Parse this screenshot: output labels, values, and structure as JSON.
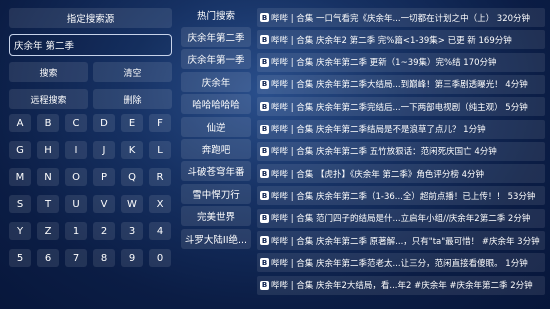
{
  "left_panel": {
    "specify_source_label": "指定搜索源",
    "search_value": "庆余年 第二季",
    "search_button": "搜索",
    "clear_button": "清空",
    "remote_search_button": "远程搜索",
    "delete_button": "删除",
    "keys": [
      "A",
      "B",
      "C",
      "D",
      "E",
      "F",
      "G",
      "H",
      "I",
      "J",
      "K",
      "L",
      "M",
      "N",
      "O",
      "P",
      "Q",
      "R",
      "S",
      "T",
      "U",
      "V",
      "W",
      "X",
      "Y",
      "Z",
      "1",
      "2",
      "3",
      "4",
      "5",
      "6",
      "7",
      "8",
      "9",
      "0"
    ]
  },
  "hot": {
    "title": "热门搜索",
    "items": [
      "庆余年第二季",
      "庆余年第一季",
      "庆余年",
      "哈哈哈哈哈",
      "仙逆",
      "奔跑吧",
      "斗破苍穹年番",
      "雪中悍刀行",
      "完美世界",
      "斗罗大陆II绝..."
    ]
  },
  "results": {
    "icon": "bilibili-icon",
    "items": [
      "哔哔 | 合集  一口气看完《庆余年...一切都在计划之中（上） 320分钟",
      "哔哔 | 合集  庆余年2 第二季 完%篇<1-39集> 已更 新 169分钟",
      "哔哔 | 合集  庆余年第二季 更新（1~39集）完%结 170分钟",
      "哔哔 | 合集  庆余年第二季大结局...到巅峰！第三季剧透曝光！ 4分钟",
      "哔哔 | 合集  庆余年第二季完结后...一下两部电视剧（纯主观） 5分钟",
      "哔哔 | 合集  庆余年第二季结局是不是浪草了点儿？ 1分钟",
      "哔哔 | 合集  庆余年第二季 五竹放狠话：范闲死庆国亡 4分钟",
      "哔哔 | 合集  【虎扑】《庆余年 第二季》角色评分榜 4分钟",
      "哔哔 | 合集  庆余年第二季（1-36...全）超前点播！已上传！！ 53分钟",
      "哔哔 | 合集  范门四子的结局是什...立启年小组//庆余年2第二季 2分钟",
      "哔哔 | 合集  庆余年第二季 原著解...，只有\"ta\"最可惜！ #庆余年 3分钟",
      "哔哔 | 合集  庆余年第二季范老太...让三分，范闲直接看傻眼。 1分钟",
      "哔哔 | 合集  庆余年2大结局，看...年2 #庆余年 #庆余年第二季 2分钟"
    ]
  },
  "colors": {
    "background": "#0b1d45",
    "button_fill": "rgba(255,255,255,0.10)",
    "input_border": "#c7d3ea"
  }
}
